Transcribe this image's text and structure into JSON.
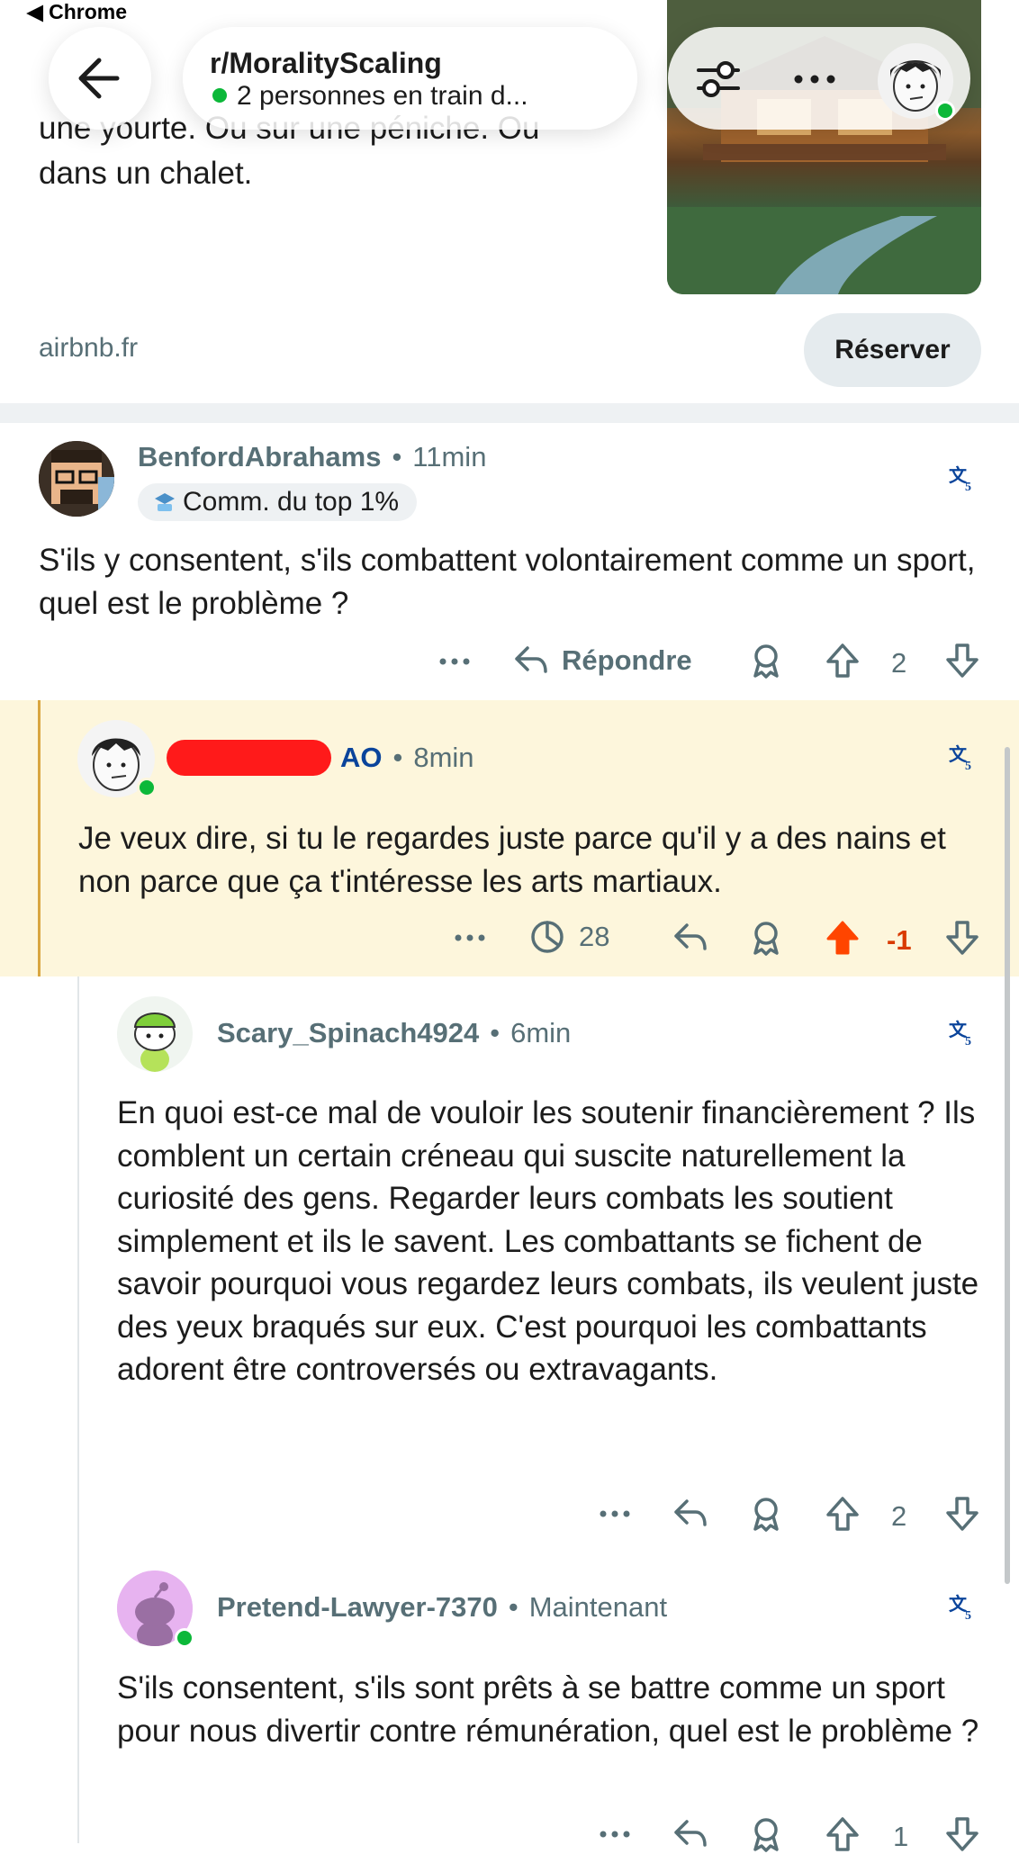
{
  "status_bar": {
    "back_label": "◀ Chrome"
  },
  "header": {
    "subreddit": "r/MoralityScaling",
    "online_text": "2 personnes en train d..."
  },
  "ad": {
    "text_lines": [
      "une yourte. Ou sur une péniche. Ou",
      "dans un chalet."
    ],
    "domain": "airbnb.fr",
    "cta_label": "Réserver"
  },
  "comments": [
    {
      "username": "BenfordAbrahams",
      "time": "11min",
      "flair": "Comm. du top 1%",
      "body": "S'ils y consentent, s'ils combattent volontairement comme un sport, quel est le problème ?",
      "reply_label": "Répondre",
      "score": "2"
    },
    {
      "op_tag": "AO",
      "time": "8min",
      "body": "Je veux dire, si tu le regardes juste parce qu'il y a des nains et non parce que ça t'intéresse les arts martiaux.",
      "views": "28",
      "score": "-1"
    },
    {
      "username": "Scary_Spinach4924",
      "time": "6min",
      "body": "En quoi est-ce mal de vouloir les soutenir financièrement ? Ils comblent un certain créneau qui suscite naturellement la curiosité des gens. Regarder leurs combats les soutient simplement et ils le savent. Les combattants se fichent de savoir pourquoi vous regardez leurs combats, ils veulent juste des yeux braqués sur eux. C'est pourquoi les combattants adorent être controversés ou extravagants.",
      "score": "2"
    },
    {
      "username": "Pretend-Lawyer-7370",
      "time": "Maintenant",
      "body": "S'ils consentent, s'ils sont prêts à se battre comme un sport pour nous divertir contre rémunération, quel est le problème ?",
      "score": "1"
    }
  ],
  "colors": {
    "op_highlight": "#fdf6dc",
    "upvoted": "#ff4500",
    "online": "#0cb839",
    "op_tag": "#0a449b"
  }
}
